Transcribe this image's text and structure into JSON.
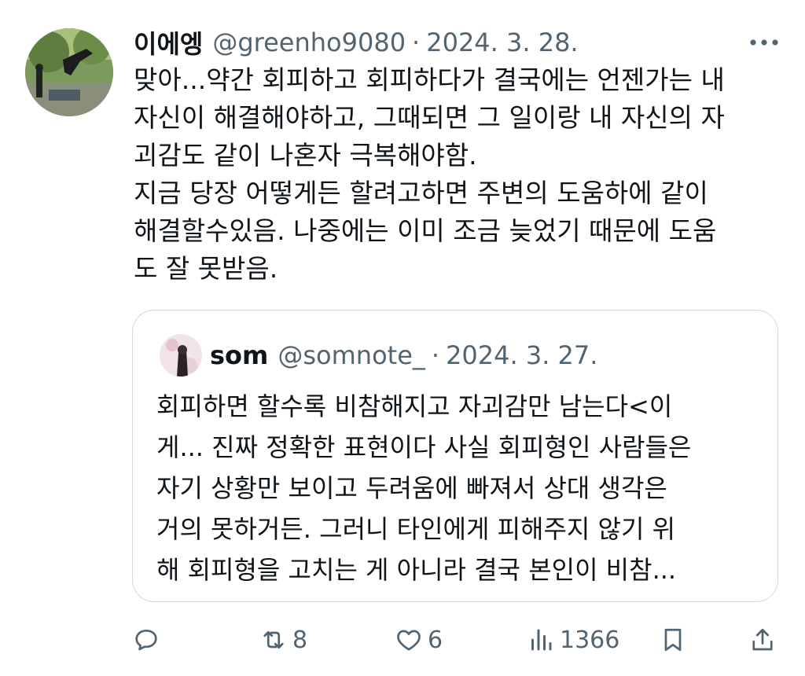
{
  "tweet": {
    "display_name": "이에엥",
    "handle": "@greenho9080",
    "separator": "·",
    "date": "2024. 3. 28.",
    "body_lines": [
      "맞아...약간 회피하고 회피하다가 결국에는 언젠가는 내",
      "자신이 해결해야하고, 그때되면 그 일이랑 내 자신의 자",
      "괴감도 같이 나혼자 극복해야함.",
      "지금 당장 어떻게든 할려고하면 주변의 도움하에 같이",
      "해결할수있음. 나중에는 이미 조금 늦었기 때문에 도움",
      "도 잘 못받음."
    ]
  },
  "quote": {
    "display_name": "som",
    "handle": "@somnote_",
    "separator": "·",
    "date": "2024. 3. 27.",
    "body_lines": [
      "회피하면 할수록 비참해지고 자괴감만 남는다<이",
      "게... 진짜 정확한 표현이다 사실 회피형인 사람들은",
      "자기 상황만 보이고 두려움에 빠져서 상대 생각은",
      "거의 못하거든. 그러니 타인에게 피해주지 않기 위",
      "해 회피형을 고치는 게 아니라 결국 본인이 비참..."
    ]
  },
  "actions": {
    "reply_icon": "reply-icon",
    "retweet_count": "8",
    "like_count": "6",
    "views_count": "1366",
    "bookmark_icon": "bookmark-icon",
    "share_icon": "share-icon"
  },
  "colors": {
    "text": "#0f1419",
    "secondary": "#536471",
    "border": "#cfd9de"
  }
}
